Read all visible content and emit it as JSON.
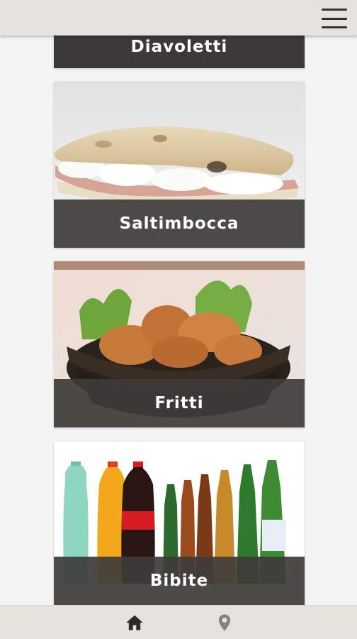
{
  "header": {
    "menu_icon": "hamburger-menu-icon"
  },
  "categories": [
    {
      "label": "Diavoletti"
    },
    {
      "label": "Saltimbocca"
    },
    {
      "label": "Fritti"
    },
    {
      "label": "Bibite"
    }
  ],
  "bottom_nav": {
    "items": [
      {
        "icon": "home-icon",
        "active": true,
        "color": "#2b2b2b"
      },
      {
        "icon": "location-pin-icon",
        "active": false,
        "color": "#8a7f7a"
      }
    ]
  },
  "colors": {
    "bar_background": "#e6e3df",
    "label_overlay": "#3e3c38",
    "page_background": "#f4f4f4"
  }
}
